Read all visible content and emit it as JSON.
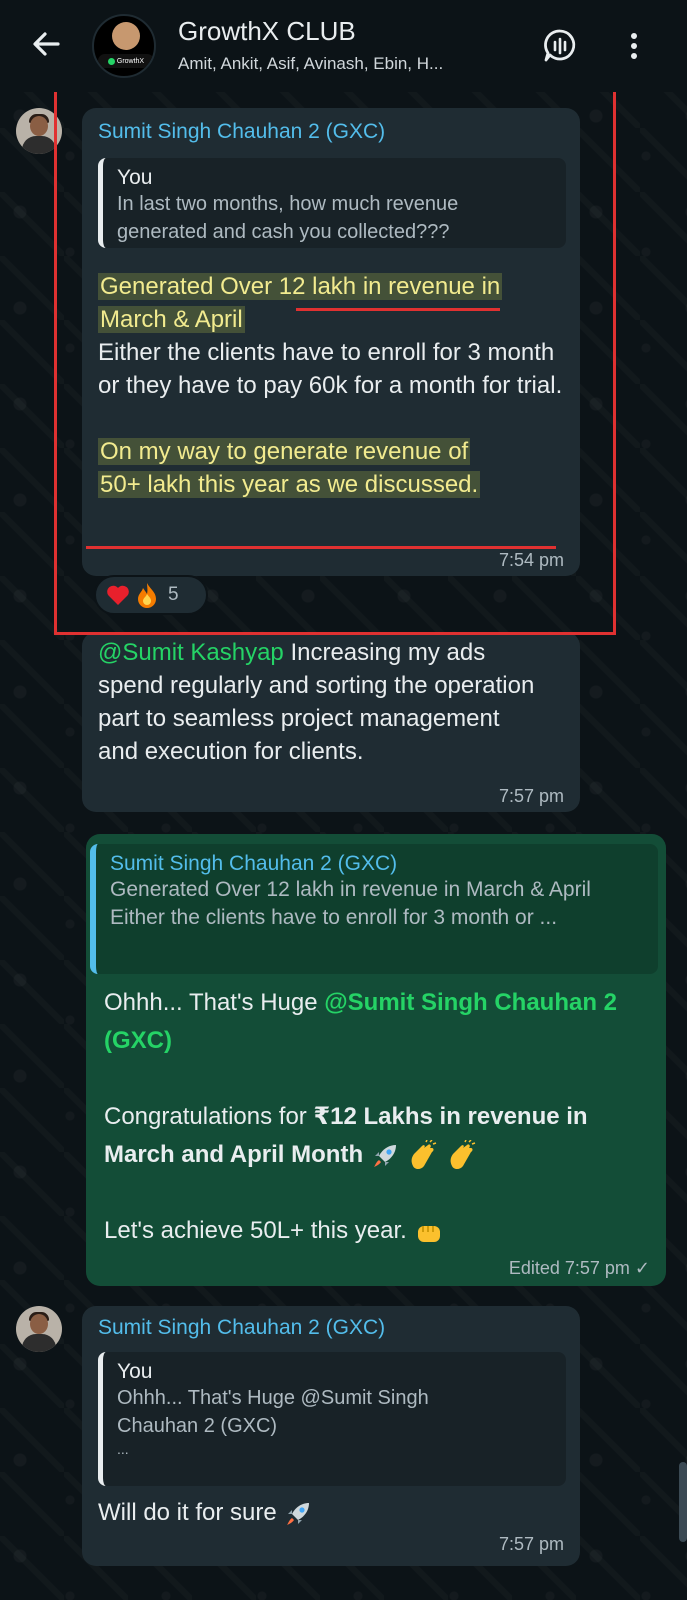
{
  "header": {
    "title": "GrowthX CLUB",
    "members": "Amit, Ankit, Asif, Avinash, Ebin, H...",
    "avatar_badge": "GrowthX"
  },
  "messages": {
    "m1": {
      "sender": "Sumit Singh Chauhan 2 (GXC)",
      "quote_author": "You",
      "quote_text": "In last two months, how much revenue generated and cash  you collected???",
      "hl1_line1": "Generated Over 12 lakh in revenue in",
      "hl1_line2": "March & April",
      "body": "Either the clients have to enroll for 3 month or they have to pay 60k for a month for trial.",
      "hl2_line1": "On my way to generate revenue of",
      "hl2_line2": "50+ lakh this year as we discussed.",
      "time": "7:54 pm",
      "reaction_count": "5"
    },
    "m2": {
      "mention": "@Sumit Kashyap",
      "text": " Increasing my ads spend regularly and sorting the operation part to seamless project management and execution for clients.",
      "time": "7:57 pm"
    },
    "m3": {
      "quote_author": "Sumit Singh Chauhan 2 (GXC)",
      "quote_line1": "Generated Over 12 lakh in revenue in March & April",
      "quote_line2": "Either the clients have to enroll for 3 month or ...",
      "p1_text": "Ohhh... That's Huge ",
      "p1_mention": "@Sumit Singh Chauhan 2 (GXC)",
      "p2_text": "Congratulations for ",
      "p2_bold": "₹12 Lakhs in revenue in March and April Month",
      "p3_text": "Let's achieve 50L+ this year.",
      "time": "Edited 7:57 pm ✓"
    },
    "m4": {
      "sender": "Sumit Singh Chauhan 2 (GXC)",
      "quote_author": "You",
      "quote_text": "Ohhh... That's Huge @Sumit Singh Chauhan 2 (GXC)",
      "quote_ellipsis": "...",
      "text": "Will do it for sure",
      "time": "7:57 pm"
    }
  },
  "colors": {
    "background": "#0c1317",
    "incoming_bubble": "#1f2c33",
    "outgoing_bubble": "#134d37",
    "sender_name": "#53bdeb",
    "mention": "#25d366",
    "highlight_box": "#e03131"
  },
  "icons": {
    "back": "arrow-left-icon",
    "voice": "voice-chat-icon",
    "menu": "more-vert-icon",
    "heart": "heart-emoji",
    "fire": "fire-emoji",
    "rocket": "rocket-emoji",
    "clap": "clap-emoji",
    "fist": "fist-emoji"
  }
}
